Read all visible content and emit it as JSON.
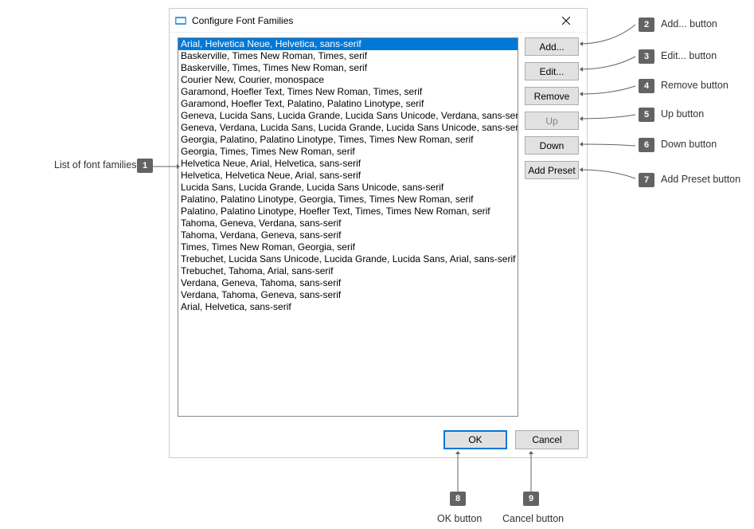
{
  "dialog": {
    "title": "Configure Font Families"
  },
  "fontList": [
    "Arial, Helvetica Neue, Helvetica, sans-serif",
    "Baskerville, Times New Roman, Times, serif",
    "Baskerville, Times, Times New Roman, serif",
    "Courier New, Courier, monospace",
    "Garamond, Hoefler Text, Times New Roman, Times, serif",
    "Garamond, Hoefler Text, Palatino, Palatino Linotype, serif",
    "Geneva, Lucida Sans, Lucida Grande, Lucida Sans Unicode, Verdana, sans-serif",
    "Geneva, Verdana, Lucida Sans, Lucida Grande, Lucida Sans Unicode, sans-serif",
    "Georgia, Palatino, Palatino Linotype, Times, Times New Roman, serif",
    "Georgia, Times, Times New Roman, serif",
    "Helvetica Neue, Arial, Helvetica, sans-serif",
    "Helvetica, Helvetica Neue, Arial, sans-serif",
    "Lucida Sans, Lucida Grande, Lucida Sans Unicode, sans-serif",
    "Palatino, Palatino Linotype, Georgia, Times, Times New Roman, serif",
    "Palatino, Palatino Linotype, Hoefler Text, Times, Times New Roman, serif",
    "Tahoma, Geneva, Verdana, sans-serif",
    "Tahoma, Verdana, Geneva, sans-serif",
    "Times, Times New Roman, Georgia, serif",
    "Trebuchet, Lucida Sans Unicode, Lucida Grande, Lucida Sans, Arial, sans-serif",
    "Trebuchet, Tahoma, Arial, sans-serif",
    "Verdana, Geneva, Tahoma, sans-serif",
    "Verdana, Tahoma, Geneva, sans-serif",
    "Arial, Helvetica, sans-serif"
  ],
  "selectedIndex": 0,
  "sideButtons": {
    "add": "Add...",
    "edit": "Edit...",
    "remove": "Remove",
    "up": "Up",
    "down": "Down",
    "addPreset": "Add Preset"
  },
  "bottomButtons": {
    "ok": "OK",
    "cancel": "Cancel"
  },
  "callouts": {
    "c1": {
      "num": "1",
      "label": "List of font families"
    },
    "c2": {
      "num": "2",
      "label": "Add... button"
    },
    "c3": {
      "num": "3",
      "label": "Edit... button"
    },
    "c4": {
      "num": "4",
      "label": "Remove button"
    },
    "c5": {
      "num": "5",
      "label": "Up button"
    },
    "c6": {
      "num": "6",
      "label": "Down button"
    },
    "c7": {
      "num": "7",
      "label": "Add Preset button"
    },
    "c8": {
      "num": "8",
      "label": "OK button"
    },
    "c9": {
      "num": "9",
      "label": "Cancel button"
    }
  }
}
